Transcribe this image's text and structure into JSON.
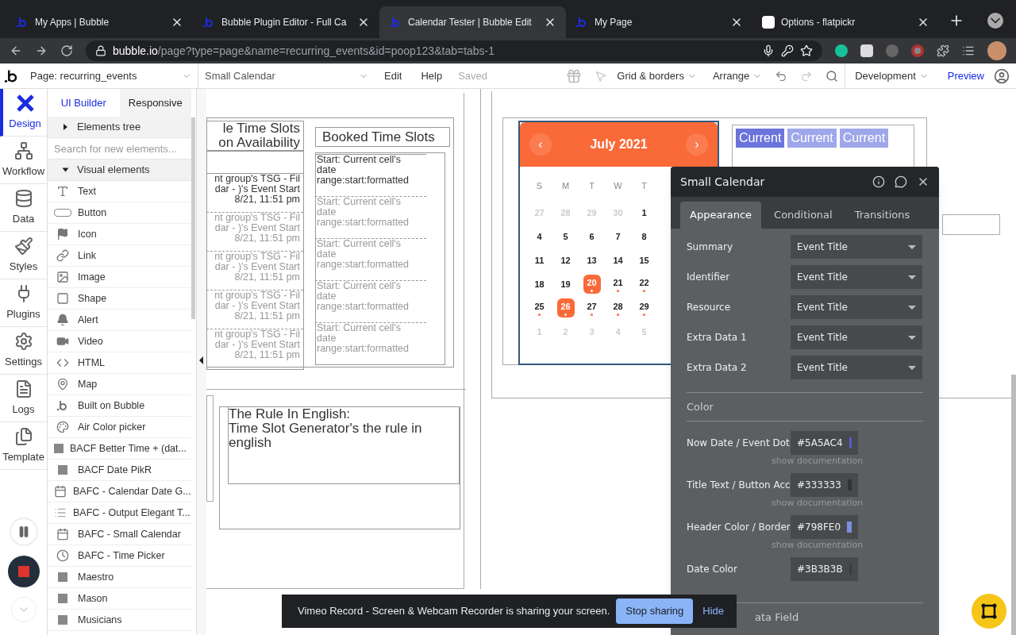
{
  "browser": {
    "tabs": [
      {
        "title": "My Apps | Bubble",
        "selected": false
      },
      {
        "title": "Bubble Plugin Editor - Full Ca",
        "selected": false
      },
      {
        "title": "Calendar Tester | Bubble Edit",
        "selected": true
      },
      {
        "title": "My Page",
        "selected": false
      },
      {
        "title": "Options - flatpickr",
        "selected": false
      }
    ],
    "url": {
      "host": "bubble.io",
      "path": "/page?type=page&name=recurring_events&id=poop123&tab=tabs-1"
    }
  },
  "toolbar": {
    "page": "Page: recurring_events",
    "element": "Small Calendar",
    "menus": [
      "Edit",
      "Help"
    ],
    "status": "Saved",
    "grid": "Grid & borders",
    "arrange": "Arrange",
    "environment": "Development",
    "preview": "Preview"
  },
  "nav": [
    {
      "label": "Design",
      "selected": true
    },
    {
      "label": "Workflow",
      "selected": false
    },
    {
      "label": "Data",
      "selected": false
    },
    {
      "label": "Styles",
      "selected": false
    },
    {
      "label": "Plugins",
      "selected": false
    },
    {
      "label": "Settings",
      "selected": false
    },
    {
      "label": "Logs",
      "selected": false
    },
    {
      "label": "Template",
      "selected": false
    }
  ],
  "palette": {
    "tabs": [
      {
        "label": "UI Builder",
        "selected": true
      },
      {
        "label": "Responsive",
        "selected": false
      }
    ],
    "tree": {
      "label": "Elements tree",
      "expanded": false
    },
    "search": {
      "placeholder": "Search for new elements..."
    },
    "section": {
      "label": "Visual elements",
      "expanded": true
    },
    "items": [
      "Text",
      "Button",
      "Icon",
      "Link",
      "Image",
      "Shape",
      "Alert",
      "Video",
      "HTML",
      "Map",
      "Built on Bubble",
      "Air Color picker",
      "BACF Better Time + (dat...",
      "BACF Date PikR",
      "BAFC - Calendar Date G...",
      "BAFC - Output Elegant T...",
      "BAFC - Small Calendar",
      "BAFC - Time Picker",
      "Maestro",
      "Mason",
      "Musicians"
    ]
  },
  "canvas": {
    "available": {
      "title_lines": [
        "le Time Slots",
        "on Availability"
      ],
      "rows": [
        {
          "lines": [
            "nt group's TSG - Fil",
            "dar - )'s Event Start",
            "8/21,  11:51 pm"
          ],
          "faded": false
        },
        {
          "lines": [
            "nt group's TSG - Fil",
            "dar - )'s Event Start",
            "8/21,  11:51 pm"
          ],
          "faded": true
        },
        {
          "lines": [
            "nt group's TSG - Fil",
            "dar - )'s Event Start",
            "8/21,  11:51 pm"
          ],
          "faded": true
        },
        {
          "lines": [
            "nt group's TSG - Fil",
            "dar - )'s Event Start",
            "8/21,  11:51 pm"
          ],
          "faded": true
        },
        {
          "lines": [
            "nt group's TSG - Fil",
            "dar - )'s Event Start",
            "8/21,  11:51 pm"
          ],
          "faded": true
        }
      ]
    },
    "booked": {
      "title": "Booked Time Slots",
      "rows": [
        {
          "lines": [
            "Start:  Current cell's",
            "date",
            "range:start:formatted"
          ],
          "faded": false
        },
        {
          "lines": [
            "Start:  Current cell's",
            "date",
            "range:start:formatted"
          ],
          "faded": true
        },
        {
          "lines": [
            "Start:  Current cell's",
            "date",
            "range:start:formatted"
          ],
          "faded": true
        },
        {
          "lines": [
            "Start:  Current cell's",
            "date",
            "range:start:formatted"
          ],
          "faded": true
        },
        {
          "lines": [
            "Start:  Current cell's",
            "date",
            "range:start:formatted"
          ],
          "faded": true
        }
      ]
    },
    "rule": {
      "lines": [
        "The Rule In English:",
        "Time Slot Generator's the rule in english"
      ]
    },
    "calendar": {
      "month": "July 2021",
      "prev": "‹",
      "next": "›",
      "weekdays": [
        "S",
        "M",
        "T",
        "W",
        "T"
      ],
      "weeks": [
        [
          {
            "label": "27",
            "muted": true,
            "selected": false,
            "dot": false
          },
          {
            "label": "28",
            "muted": true,
            "selected": false,
            "dot": false
          },
          {
            "label": "29",
            "muted": true,
            "selected": false,
            "dot": false
          },
          {
            "label": "30",
            "muted": true,
            "selected": false,
            "dot": false
          },
          {
            "label": "1",
            "muted": false,
            "selected": false,
            "dot": false
          }
        ],
        [
          {
            "label": "4",
            "muted": false,
            "selected": false,
            "dot": false
          },
          {
            "label": "5",
            "muted": false,
            "selected": false,
            "dot": false
          },
          {
            "label": "6",
            "muted": false,
            "selected": false,
            "dot": false
          },
          {
            "label": "7",
            "muted": false,
            "selected": false,
            "dot": false
          },
          {
            "label": "8",
            "muted": false,
            "selected": false,
            "dot": false
          }
        ],
        [
          {
            "label": "11",
            "muted": false,
            "selected": false,
            "dot": false
          },
          {
            "label": "12",
            "muted": false,
            "selected": false,
            "dot": false
          },
          {
            "label": "13",
            "muted": false,
            "selected": false,
            "dot": false
          },
          {
            "label": "14",
            "muted": false,
            "selected": false,
            "dot": false
          },
          {
            "label": "15",
            "muted": false,
            "selected": false,
            "dot": false
          }
        ],
        [
          {
            "label": "18",
            "muted": false,
            "selected": false,
            "dot": false
          },
          {
            "label": "19",
            "muted": false,
            "selected": false,
            "dot": false
          },
          {
            "label": "20",
            "muted": false,
            "selected": true,
            "dot": true
          },
          {
            "label": "21",
            "muted": false,
            "selected": false,
            "dot": true
          },
          {
            "label": "22",
            "muted": false,
            "selected": false,
            "dot": true
          }
        ],
        [
          {
            "label": "25",
            "muted": false,
            "selected": false,
            "dot": true
          },
          {
            "label": "26",
            "muted": false,
            "selected": true,
            "dot": true
          },
          {
            "label": "27",
            "muted": false,
            "selected": false,
            "dot": true
          },
          {
            "label": "28",
            "muted": false,
            "selected": false,
            "dot": true
          },
          {
            "label": "29",
            "muted": false,
            "selected": false,
            "dot": true
          }
        ],
        [
          {
            "label": "1",
            "muted": true,
            "selected": false,
            "dot": false
          },
          {
            "label": "2",
            "muted": true,
            "selected": false,
            "dot": false
          },
          {
            "label": "3",
            "muted": true,
            "selected": false,
            "dot": false
          },
          {
            "label": "4",
            "muted": true,
            "selected": false,
            "dot": false
          },
          {
            "label": "5",
            "muted": true,
            "selected": false,
            "dot": false
          }
        ]
      ]
    },
    "current": [
      {
        "label": "Current",
        "selected": true
      },
      {
        "label": "Current",
        "selected": false
      },
      {
        "label": "Current",
        "selected": false
      }
    ]
  },
  "panel": {
    "title": "Small Calendar",
    "tabs": [
      {
        "label": "Appearance",
        "selected": true
      },
      {
        "label": "Conditional",
        "selected": false
      },
      {
        "label": "Transitions",
        "selected": false
      }
    ],
    "fields": [
      {
        "label": "Summary",
        "value": "Event Title"
      },
      {
        "label": "Identifier",
        "value": "Event Title"
      },
      {
        "label": "Resource",
        "value": "Event Title"
      },
      {
        "label": "Extra Data 1",
        "value": "Event Title"
      },
      {
        "label": "Extra Data 2",
        "value": "Event Title"
      }
    ],
    "colors_section": "Color",
    "colors": [
      {
        "label": "Now Date / Event Dot",
        "value": "#5A5AC4",
        "color": "#5a5ac4",
        "doc": "show documentation"
      },
      {
        "label": "Title Text / Button Acc",
        "value": "#333333",
        "color": "#333333",
        "doc": "show documentation"
      },
      {
        "label": "Header Color / Border",
        "value": "#798FE0",
        "color": "#798fe0",
        "doc": "show documentation"
      },
      {
        "label": "Date Color",
        "value": "#3B3B3B",
        "color": "#3b3b3b"
      }
    ],
    "next_section": "ata Field"
  },
  "sharing": {
    "message": "Vimeo Record - Screen & Webcam Recorder is sharing your screen.",
    "stop": "Stop sharing",
    "hide": "Hide"
  }
}
